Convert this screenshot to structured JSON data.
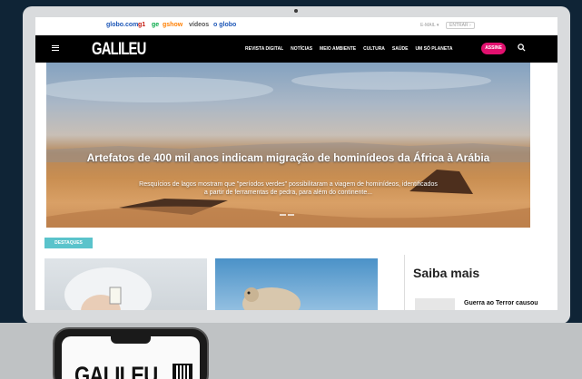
{
  "globo_bar": {
    "links": [
      "globo.com",
      "g1",
      "ge",
      "gshow",
      "vídeos",
      "o globo"
    ],
    "email": "E-MAIL ▾",
    "entrar": "ENTRAR ›"
  },
  "navbar": {
    "brand": "GALILEU",
    "items": [
      "REVISTA DIGITAL",
      "NOTÍCIAS",
      "MEIO AMBIENTE",
      "CULTURA",
      "SAÚDE",
      "UM SÓ PLANETA"
    ],
    "subscribe": "ASSINE"
  },
  "hero": {
    "title": "Artefatos de 400 mil anos indicam migração de hominídeos da África à Arábia",
    "subtitle": "Resquícios de lagos mostram que \"períodos verdes\" possibilitaram a viagem de hominídeos, identificados a partir de ferramentas de pedra, para além do continente..."
  },
  "section": {
    "badge": "DESTAQUES"
  },
  "sidebar": {
    "heading": "Saiba mais",
    "article_title": "Guerra ao Terror causou"
  },
  "phone": {
    "logo": "GALILEU"
  },
  "colors": {
    "assine": "#e2106f",
    "destaques": "#5ac3cb",
    "page_background": "#0f2436"
  }
}
